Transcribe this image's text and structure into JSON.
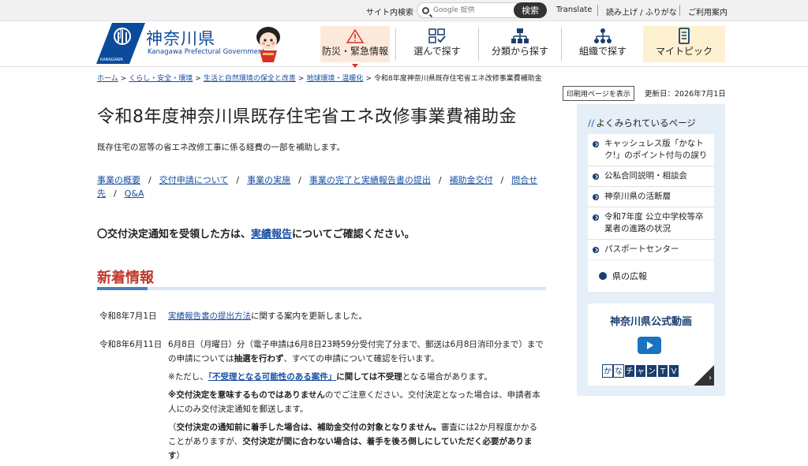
{
  "utility": {
    "search_label": "サイト内検索",
    "search_placeholder": "Google 提供",
    "search_button": "検索",
    "translate": "Translate",
    "read_aloud": "読み上げ / ふりがな",
    "usage_guide": "ご利用案内"
  },
  "header": {
    "logo_title": "神奈川県",
    "logo_sub": "Kanagawa Prefectural Government",
    "logo_small": "KANAGAWA",
    "nav": [
      {
        "label": "防災・緊急情報"
      },
      {
        "label": "選んで探す"
      },
      {
        "label": "分類から探す"
      },
      {
        "label": "組織で探す"
      },
      {
        "label": "マイトピック"
      }
    ]
  },
  "breadcrumb": [
    "ホーム",
    "くらし・安全・環境",
    "生活と自然環境の保全と改善",
    "地球環境・温暖化",
    "令和8年度神奈川県既存住宅省エネ改修事業費補助金"
  ],
  "print_label": "印刷用ページを表示",
  "updated": "更新日：2026年7月1日",
  "page": {
    "title": "令和8年度神奈川県既存住宅省エネ改修事業費補助金",
    "lead": "既存住宅の窓等の省エネ改修工事に係る経費の一部を補助します。",
    "anchors": [
      "事業の概要",
      "交付申請について",
      "事業の実施",
      "事業の完了と実績報告書の提出",
      "補助金交付",
      "問合せ先",
      "Q&A"
    ],
    "notice_pre": "〇交付決定通知を受領した方は、",
    "notice_link": "実績報告",
    "notice_post": "についてご確認ください。",
    "news_heading": "新着情報"
  },
  "news": [
    {
      "date": "令和8年7月1日",
      "link": "実績報告書の提出方法",
      "text": "に関する案内を更新しました。"
    },
    {
      "date": "令和8年6月11日",
      "p1_a": "6月8日（月曜日）分（電子申請は6月8日23時59分受付完了分まで、郵送は6月8日消印分まで）までの申請については",
      "p1_b": "抽選を行わず",
      "p1_c": "、すべての申請について確認を行います。",
      "p2_a": "※ただし、",
      "p2_link": "「不受理となる可能性のある案件」",
      "p2_b": "に関しては",
      "p2_c": "不受理",
      "p2_d": "となる場合があります。",
      "p3_a": "※交付決定を意味するものではありません",
      "p3_b": "のでご注意ください。交付決定となった場合は、申請者本人にのみ交付決定通知を郵送します。",
      "p4_a": "（",
      "p4_b": "交付決定の通知前に着手した場合は、補助金交付の対象となりません。",
      "p4_c": "審査には2か月程度かかることがありますが、",
      "p4_d": "交付決定が間に合わない場合は、着手を後ろ倒しにしていただく必要があります",
      "p4_e": "）"
    }
  ],
  "sidebar": {
    "title": "よくみられているページ",
    "items": [
      "キャッシュレス版「かなトク!」のポイント付与の誤り",
      "公私合同説明・相談会",
      "神奈川県の活断層",
      "令和7年度 公立中学校等卒業者の進路の状況",
      "パスポートセンター"
    ],
    "pr": "県の広報",
    "video_title": "神奈川県公式動画",
    "kana": [
      "か",
      "な",
      "チ",
      "ャ",
      "ン",
      "T",
      "V"
    ]
  }
}
